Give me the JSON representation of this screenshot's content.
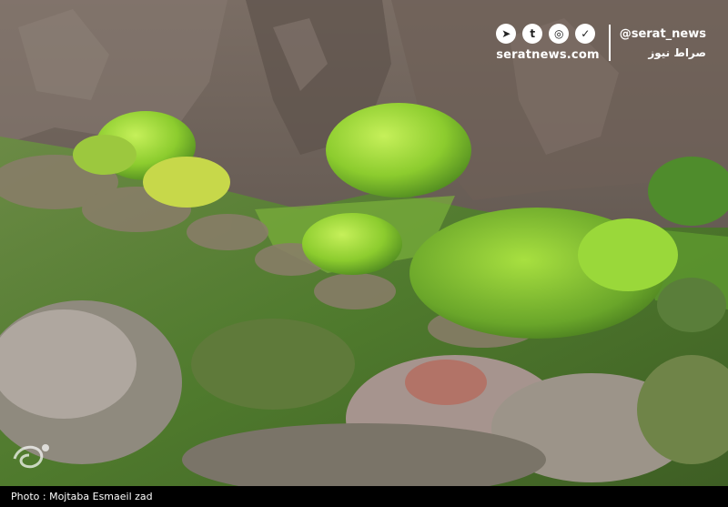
{
  "watermark": {
    "handle": "@serat_news",
    "site": "seratnews.com",
    "persian_name": "صراط نیوز",
    "social_icons": [
      "telegram-icon",
      "twitter-icon",
      "instagram-icon",
      "messenger-icon"
    ]
  },
  "caption": {
    "credit": "Photo : Mojtaba Esmaeil zad"
  },
  "colors": {
    "rock": "#6f625a",
    "rock_dark": "#4a423d",
    "foliage_bright": "#9fd23a",
    "foliage_mid": "#6fa82a",
    "grass": "#5b8a2e",
    "shrub_pink": "#b99aa0",
    "footer_bg": "#000000"
  }
}
